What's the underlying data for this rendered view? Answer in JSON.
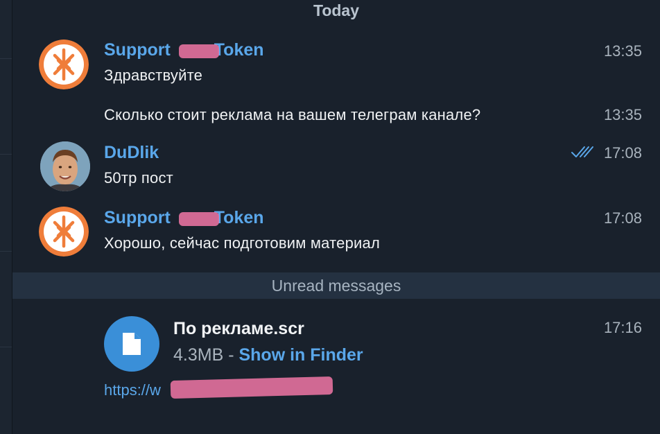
{
  "date_separator": "Today",
  "unread_label": "Unread messages",
  "messages": [
    {
      "sender": "Support Token",
      "sender_prefix": "Support ",
      "sender_suffix": "Token",
      "time": "13:35",
      "lines": [
        "Здравствуйте"
      ]
    },
    {
      "time": "13:35",
      "lines": [
        "Сколько стоит реклама на вашем телеграм канале?"
      ]
    },
    {
      "sender": "DuDlik",
      "time": "17:08",
      "status": "read",
      "lines": [
        "50тр пост"
      ]
    },
    {
      "sender": "Support Token",
      "sender_prefix": "Support ",
      "sender_suffix": "Token",
      "time": "17:08",
      "lines": [
        "Хорошо, сейчас подготовим материал"
      ]
    }
  ],
  "file_message": {
    "file_name": "По рекламе.scr",
    "file_size": "4.3MB",
    "separator": " - ",
    "action_label": "Show in Finder",
    "time": "17:16",
    "url_visible": "https://w"
  },
  "colors": {
    "background": "#19212c",
    "accent": "#5aa7ea",
    "unread_bar": "#243141",
    "redaction": "#e0709c",
    "logo_orange": "#ef7d3a"
  },
  "icons": {
    "support_avatar": "asterisk-logo-icon",
    "file": "document-icon",
    "status": "double-check-icon"
  }
}
